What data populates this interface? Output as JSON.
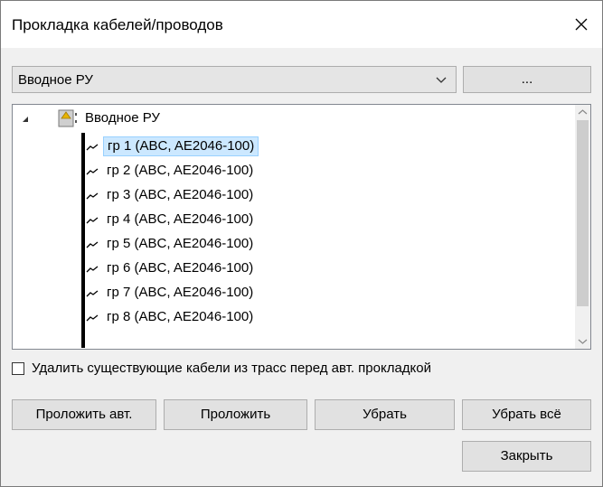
{
  "window": {
    "title": "Прокладка кабелей/проводов"
  },
  "combo": {
    "value": "Вводное РУ"
  },
  "dots_button": {
    "label": "..."
  },
  "tree": {
    "root": "Вводное РУ",
    "items": [
      "гр 1 (ABC, AE2046-100)",
      "гр 2 (ABC, AE2046-100)",
      "гр 3 (ABC, AE2046-100)",
      "гр 4 (ABC, AE2046-100)",
      "гр 5 (ABC, AE2046-100)",
      "гр 6 (ABC, AE2046-100)",
      "гр 7 (ABC, AE2046-100)",
      "гр 8 (ABC, AE2046-100)"
    ],
    "selected_index": 0
  },
  "checkbox": {
    "label": "Удалить существующие кабели из трасс перед авт. прокладкой",
    "checked": false
  },
  "buttons": {
    "auto_lay": "Проложить авт.",
    "lay": "Проложить",
    "remove": "Убрать",
    "remove_all": "Убрать всё",
    "close": "Закрыть"
  },
  "colors": {
    "selection": "#cce8ff",
    "selection_border": "#99d1ff",
    "icon_accent": "#e8b400"
  },
  "icons": {
    "close": "close-icon",
    "dropdown": "chevron-down-icon",
    "expander": "triangle-expanded-icon",
    "root": "switchboard-icon",
    "item": "cable-icon"
  }
}
